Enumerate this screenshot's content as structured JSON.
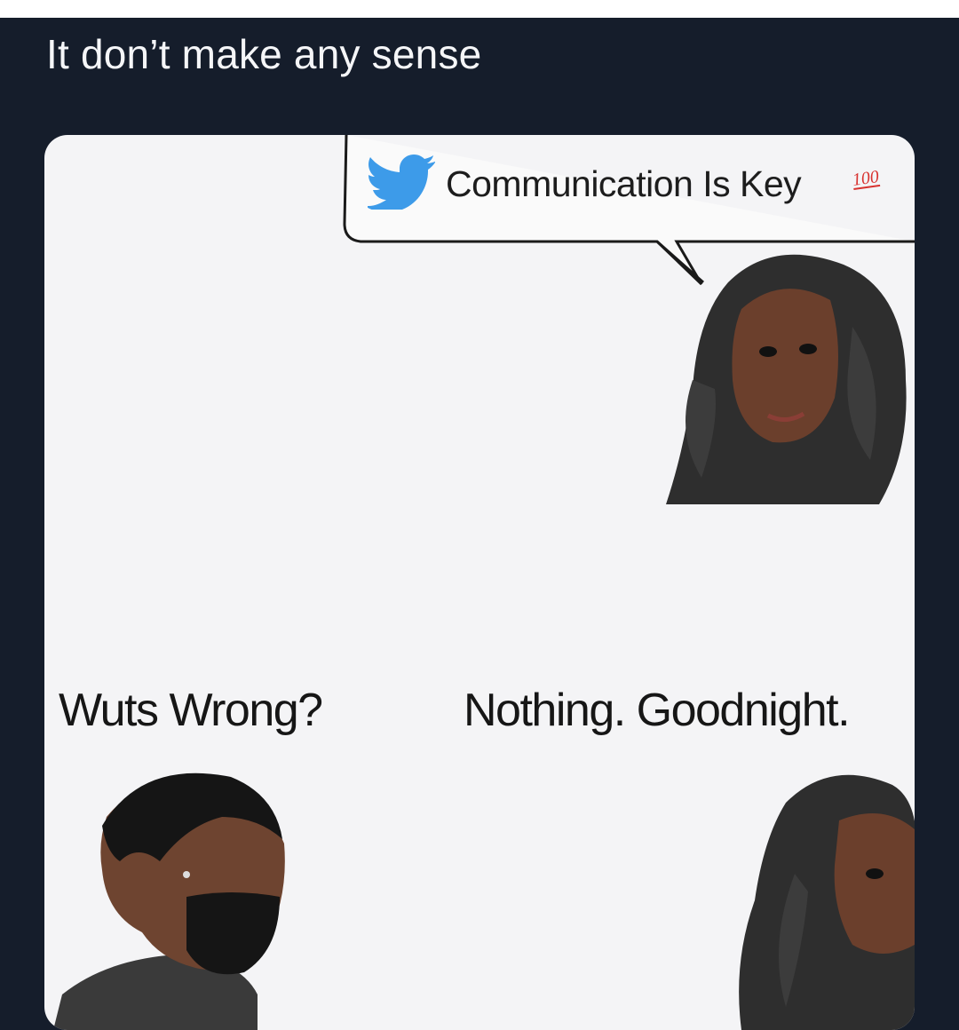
{
  "caption": "It don’t make any sense",
  "meme": {
    "speech_bubble_text": "Communication Is Key",
    "hundred_emoji_text": "100",
    "left_dialogue": "Wuts Wrong?",
    "right_dialogue": "Nothing. Goodnight."
  },
  "colors": {
    "background": "#151d2b",
    "caption_text": "#f5f6f8",
    "meme_panel": "#f4f4f6",
    "twitter_blue": "#3d9be9",
    "hundred_red": "#d8322f"
  },
  "icons": [
    "twitter-bird-icon",
    "hundred-points-icon"
  ]
}
